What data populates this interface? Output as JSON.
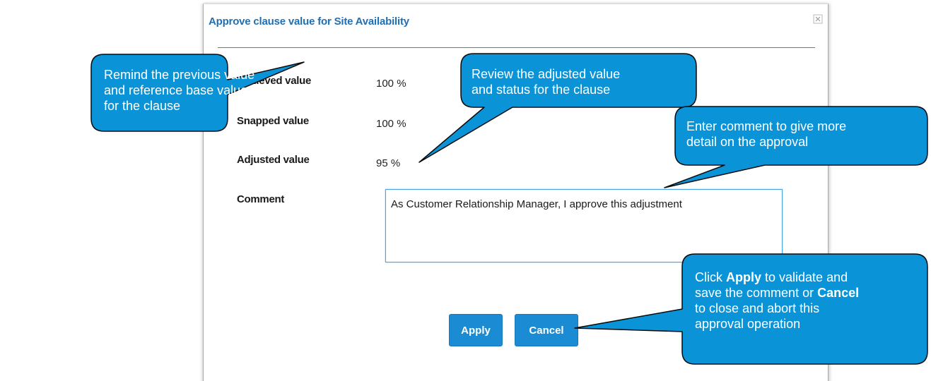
{
  "dialog": {
    "title": "Approve clause value for Site Availability",
    "close_icon": "close-icon",
    "fields": {
      "achieved_label": "Achieved value",
      "achieved_value": "100 %",
      "snapped_label": "Snapped value",
      "snapped_value": "100 %",
      "adjusted_label": "Adjusted value",
      "adjusted_value": "95 %",
      "comment_label": "Comment",
      "comment_value": "As Customer Relationship Manager, I approve this adjustment"
    },
    "buttons": {
      "apply_label": "Apply",
      "cancel_label": "Cancel"
    }
  },
  "callouts": {
    "left_1": "Remind the previous value",
    "left_2": "and reference base value",
    "left_3": "for the clause",
    "review_1": "Review the adjusted value",
    "review_2": "and status for the clause",
    "comment_1": "Enter comment to give more",
    "comment_2": "detail on the approval",
    "apply_pre": "Click ",
    "apply_bold1": "Apply",
    "apply_mid": " to validate and",
    "apply_line2_pre": "save the comment or ",
    "apply_bold2": "Cancel",
    "apply_line3": "to close and abort this",
    "apply_line4": "approval operation"
  },
  "colors": {
    "title": "#1f6fb2",
    "button": "#1b8bd4",
    "callout_fill": "#0b93d8",
    "callout_stroke": "#0a0a0a"
  }
}
